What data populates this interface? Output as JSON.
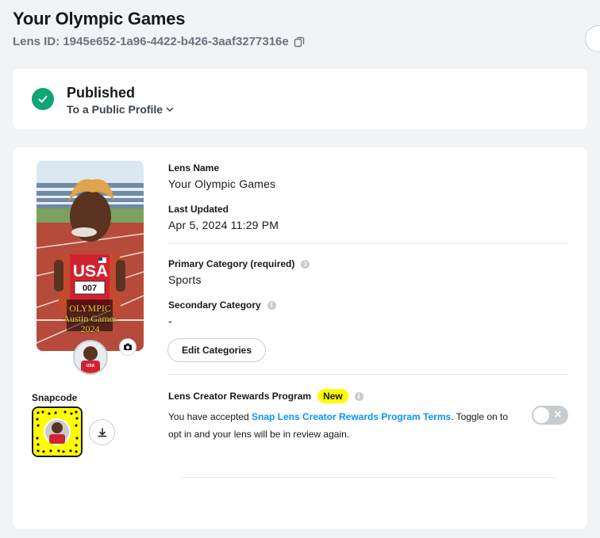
{
  "header": {
    "title": "Your Olympic Games",
    "lens_id": "Lens ID: 1945e652-1a96-4422-b426-3aaf3277316e"
  },
  "status": {
    "title": "Published",
    "subtitle": "To a Public Profile",
    "color": "#10a575"
  },
  "details": {
    "lens_name_label": "Lens Name",
    "lens_name": "Your Olympic Games",
    "last_updated_label": "Last Updated",
    "last_updated": "Apr 5, 2024 11:29 PM",
    "primary_category_label": "Primary Category (required)",
    "primary_category": "Sports",
    "secondary_category_label": "Secondary Category",
    "secondary_category": "-",
    "edit_categories_label": "Edit Categories"
  },
  "preview": {
    "jersey_text": "USA",
    "bib_number": "007",
    "caption_line1": "OLYMPIC",
    "caption_line2": "Austin Games",
    "caption_line3": "2024",
    "avatar_text": "USA"
  },
  "snapcode": {
    "label": "Snapcode",
    "color": "#fffc00"
  },
  "rewards": {
    "title": "Lens Creator Rewards Program",
    "badge": "New",
    "text_before": "You have accepted ",
    "link": "Snap Lens Creator Rewards Program Terms",
    "text_after": ". Toggle on to opt in and your lens will be in review again.",
    "toggle_on": false,
    "link_color": "#0894fa"
  }
}
